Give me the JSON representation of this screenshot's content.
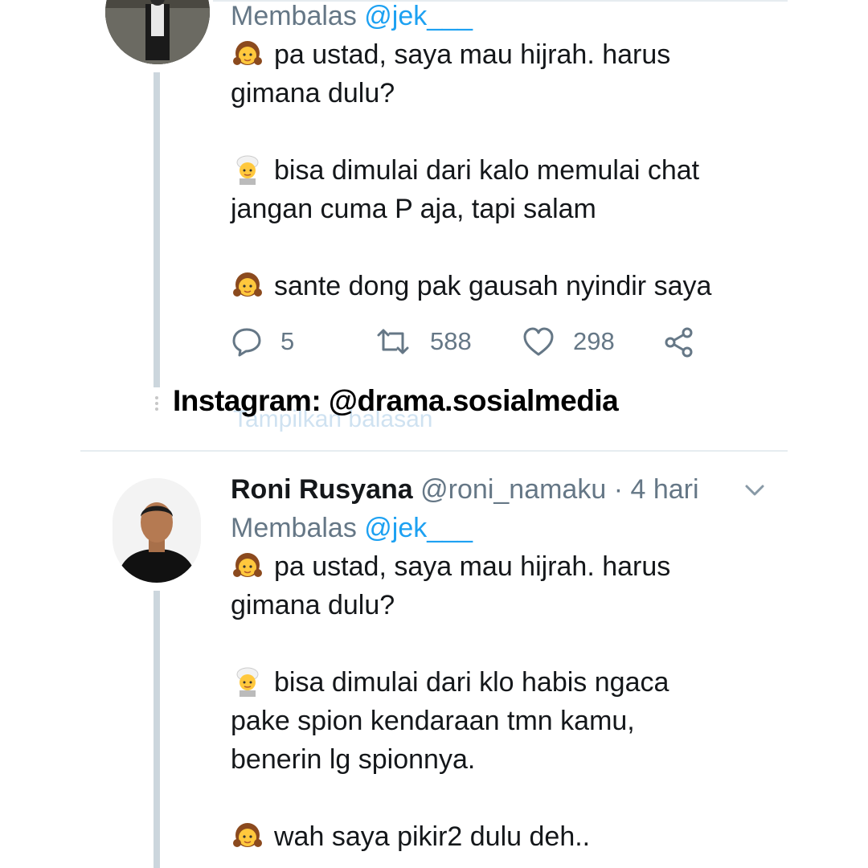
{
  "tweet1": {
    "replying_prefix": "Membalas ",
    "replying_handle": "@jek___",
    "lines": [
      "pa ustad, saya mau hijrah. harus",
      "gimana dulu?",
      "",
      "bisa dimulai dari kalo memulai chat",
      "jangan cuma P aja, tapi salam",
      "",
      "sante dong pak gausah nyindir saya"
    ],
    "reply_count": "5",
    "retweet_count": "588",
    "like_count": "298"
  },
  "watermark": {
    "text": "Instagram: @drama.sosialmedia",
    "ghost_text": "Tampilkan balasan"
  },
  "tweet2": {
    "name": "Roni Rusyana",
    "handle": "@roni_namaku",
    "separator": " · ",
    "time": "4 hari",
    "replying_prefix": "Membalas ",
    "replying_handle": "@jek___",
    "lines": [
      "pa ustad, saya mau hijrah. harus",
      "gimana dulu?",
      "",
      "bisa dimulai dari klo habis ngaca",
      "pake spion kendaraan tmn kamu,",
      "benerin lg spionnya.",
      "",
      "wah saya pikir2 dulu deh.."
    ]
  },
  "icons": {
    "girl": "girl-emoji",
    "ustad": "man-with-turban-emoji",
    "reply": "reply-icon",
    "retweet": "retweet-icon",
    "like": "heart-icon",
    "share": "share-icon",
    "menu": "chevron-down-icon"
  },
  "colors": {
    "secondary_text": "#657786",
    "link": "#1da1f2",
    "thread_line": "#ccd6dd"
  }
}
